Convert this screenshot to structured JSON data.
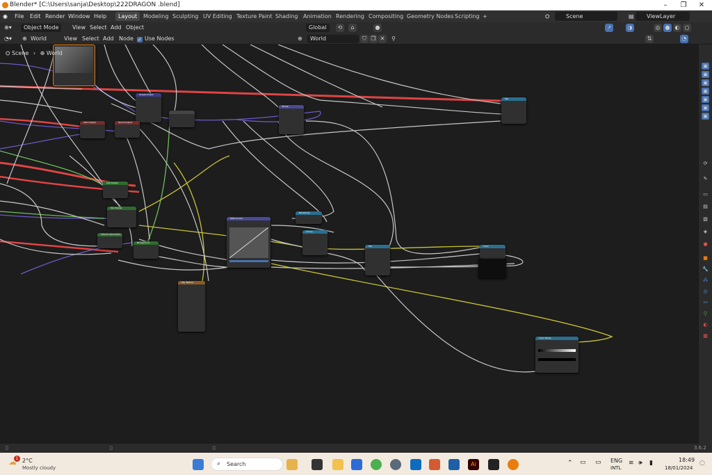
{
  "window": {
    "title": "Blender* [C:\\Users\\sanja\\Desktop\\222DRAGON .blend]"
  },
  "menus": [
    "File",
    "Edit",
    "Render",
    "Window",
    "Help"
  ],
  "workspaces": [
    "Layout",
    "Modeling",
    "Sculpting",
    "UV Editing",
    "Texture Paint",
    "Shading",
    "Animation",
    "Rendering",
    "Compositing",
    "Geometry Nodes",
    "Scripting"
  ],
  "active_workspace": "Layout",
  "add_workspace": "+",
  "scene": "Scene",
  "view_layer": "ViewLayer",
  "header1": {
    "mode": "Object Mode",
    "view": "View",
    "select": "Select",
    "add": "Add",
    "object": "Object",
    "orientation": "Global"
  },
  "header2": {
    "type": "World",
    "view": "View",
    "select": "Select",
    "add": "Add",
    "node": "Node",
    "use_nodes": "Use Nodes",
    "world_name": "World"
  },
  "breadcrumb": {
    "scene": "Scene",
    "world": "World"
  },
  "version": "3.6.2",
  "taskbar": {
    "temp": "2°C",
    "weather": "Mostly cloudy",
    "search": "Search",
    "lang": "ENG",
    "layout": "INTL",
    "time": "18:49",
    "date": "18/01/2024",
    "badge": "1"
  },
  "nodes": [
    {
      "id": "n1",
      "label": "",
      "color": "#555"
    },
    {
      "id": "n2",
      "label": "Displacement",
      "color": "#3b3b8a"
    },
    {
      "id": "n3",
      "label": "AOV Output",
      "color": "#7a2a2a"
    },
    {
      "id": "n4",
      "label": "World Output",
      "color": "#7a2a2a"
    },
    {
      "id": "n5",
      "label": "Bump",
      "color": "#4a4a9a"
    },
    {
      "id": "n6",
      "label": "Mix",
      "color": "#2a6f8f"
    },
    {
      "id": "n7",
      "label": "Add Shader",
      "color": "#2e6b2e"
    },
    {
      "id": "n8",
      "label": "Mix Shader",
      "color": "#2e6b2e"
    },
    {
      "id": "n9",
      "label": "Volume Absorption",
      "color": "#2e6b2e"
    },
    {
      "id": "n10",
      "label": "Background",
      "color": "#2e6b2e"
    },
    {
      "id": "n11",
      "label": "RGB Curves",
      "color": "#4a4a9a"
    },
    {
      "id": "n12",
      "label": "Blackbody",
      "color": "#2a6f8f"
    },
    {
      "id": "n13",
      "label": "Clamp",
      "color": "#2a6f8f"
    },
    {
      "id": "n14",
      "label": "Mix",
      "color": "#2a6f8f"
    },
    {
      "id": "n15",
      "label": "Color",
      "color": "#2a6f8f"
    },
    {
      "id": "n16",
      "label": "Sky Texture",
      "color": "#8a5a2a"
    },
    {
      "id": "n17",
      "label": "Color Ramp",
      "color": "#2a6f8f"
    }
  ]
}
